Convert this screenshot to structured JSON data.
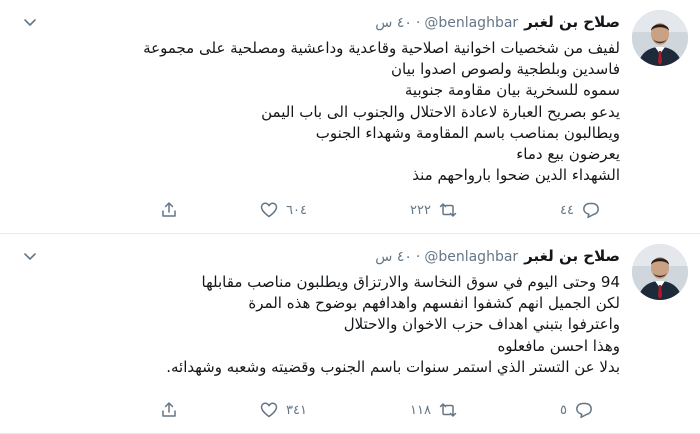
{
  "tweets": [
    {
      "name": "صلاح بن لغبر",
      "handle": "@benlaghbar",
      "time": "٤٠ س",
      "lines": [
        "لفيف من شخصيات اخوانية اصلاحية وقاعدية وداعشية ومصلحية على مجموعة",
        "فاسدين وبلطجية ولصوص اصدوا بيان",
        "سموه للسخرية بيان مقاومة جنوبية",
        "يدعو بصريح العبارة لاعادة الاحتلال والجنوب الى باب اليمن",
        "ويطالبون بمناصب باسم المقاومة وشهداء الجنوب",
        "يعرضون بيع دماء",
        "الشهداء الدين ضحوا بارواحهم منذ"
      ],
      "replies": "٤٤",
      "retweets": "٢٢٢",
      "likes": "٦٠٤"
    },
    {
      "name": "صلاح بن لغبر",
      "handle": "@benlaghbar",
      "time": "٤٠ س",
      "lines": [
        "94 وحتى اليوم في سوق النخاسة والارتزاق ويطلبون مناصب مقابلها",
        "لكن الجميل انهم كشفوا انفسهم واهدافهم بوضوح هذه المرة",
        "واعترفوا بتبني اهداف حزب الاخوان والاحتلال",
        "وهذا احسن مافعلوه",
        "بدلا عن التستر الذي استمر سنوات باسم الجنوب وقضيته وشعبه وشهدائه."
      ],
      "replies": "٥",
      "retweets": "١١٨",
      "likes": "٣٤١"
    }
  ],
  "icons": {
    "caret": "chevron-down-icon",
    "reply": "reply-icon",
    "retweet": "retweet-icon",
    "like": "heart-icon",
    "share": "share-icon"
  },
  "colors": {
    "text": "#14171a",
    "muted": "#657786",
    "divider": "#e6ecf0",
    "avatar_suit": "#1c2a3a",
    "avatar_tie": "#b0182c"
  }
}
